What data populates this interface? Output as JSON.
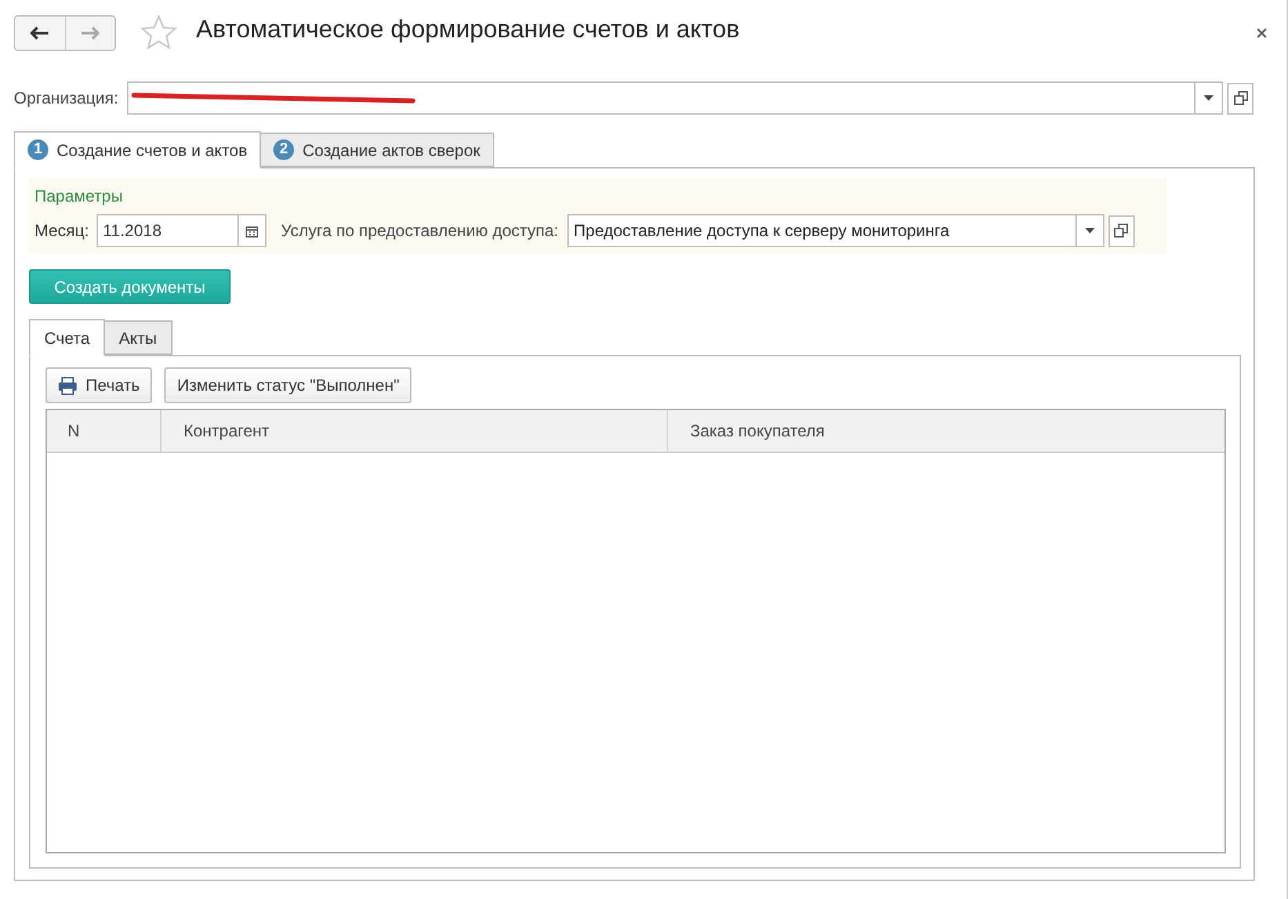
{
  "window": {
    "title": "Автоматическое формирование счетов и актов"
  },
  "organization": {
    "label": "Организация:",
    "redacted": true
  },
  "tabs": [
    {
      "number": "1",
      "label": "Создание счетов и актов",
      "selected": true
    },
    {
      "number": "2",
      "label": "Создание актов сверок",
      "selected": false
    }
  ],
  "parameters": {
    "title": "Параметры",
    "month": {
      "label": "Месяц:",
      "value": "11.2018"
    },
    "service": {
      "label": "Услуга по предоставлению доступа:",
      "value": "Предоставление доступа к серверу мониторинга"
    }
  },
  "create_button": {
    "label": "Создать документы"
  },
  "inner_tabs": [
    {
      "label": "Счета",
      "selected": true
    },
    {
      "label": "Акты",
      "selected": false
    }
  ],
  "toolbar_buttons": [
    {
      "label": "Печать",
      "kind": "print"
    },
    {
      "label": "Изменить статус \"Выполнен\"",
      "kind": "plain"
    }
  ],
  "table": {
    "columns": [
      "N",
      "Контрагент",
      "Заказ покупателя"
    ]
  }
}
